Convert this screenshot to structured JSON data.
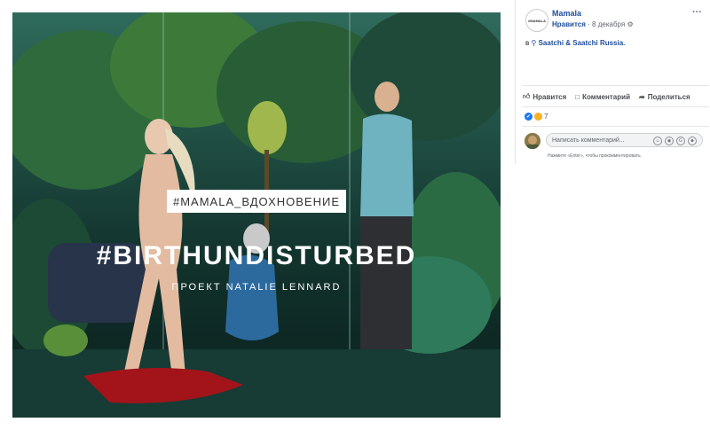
{
  "post": {
    "image": {
      "tag_label": "#MAMALA_ВДОХНОВЕНИЕ",
      "headline": "#BIRTHUNDISTURBED",
      "subline": "ПРОЕКТ NATALIE LENNARD"
    },
    "header": {
      "avatar_text": "#MAMALA",
      "page_name": "Mamala",
      "like_label": "Нравится",
      "separator": "·",
      "date": "8 декабря",
      "privacy_icon": "globe-icon",
      "more_label": "···"
    },
    "location": {
      "prefix": "в",
      "place": "Saatchi & Saatchi Russia."
    },
    "actions": [
      {
        "label": "Нравится",
        "icon": "thumbs-up-icon"
      },
      {
        "label": "Комментарий",
        "icon": "comment-icon"
      },
      {
        "label": "Поделиться",
        "icon": "share-icon"
      }
    ],
    "reactions": {
      "count": "7",
      "types": [
        "like",
        "haha"
      ]
    },
    "comment": {
      "placeholder": "Написать комментарий...",
      "hint": "Нажмите «Enter», чтобы прокомментировать."
    }
  },
  "colors": {
    "link": "#1e4e9c",
    "like_blue": "#1877f2",
    "haha_yellow": "#f7b125"
  }
}
